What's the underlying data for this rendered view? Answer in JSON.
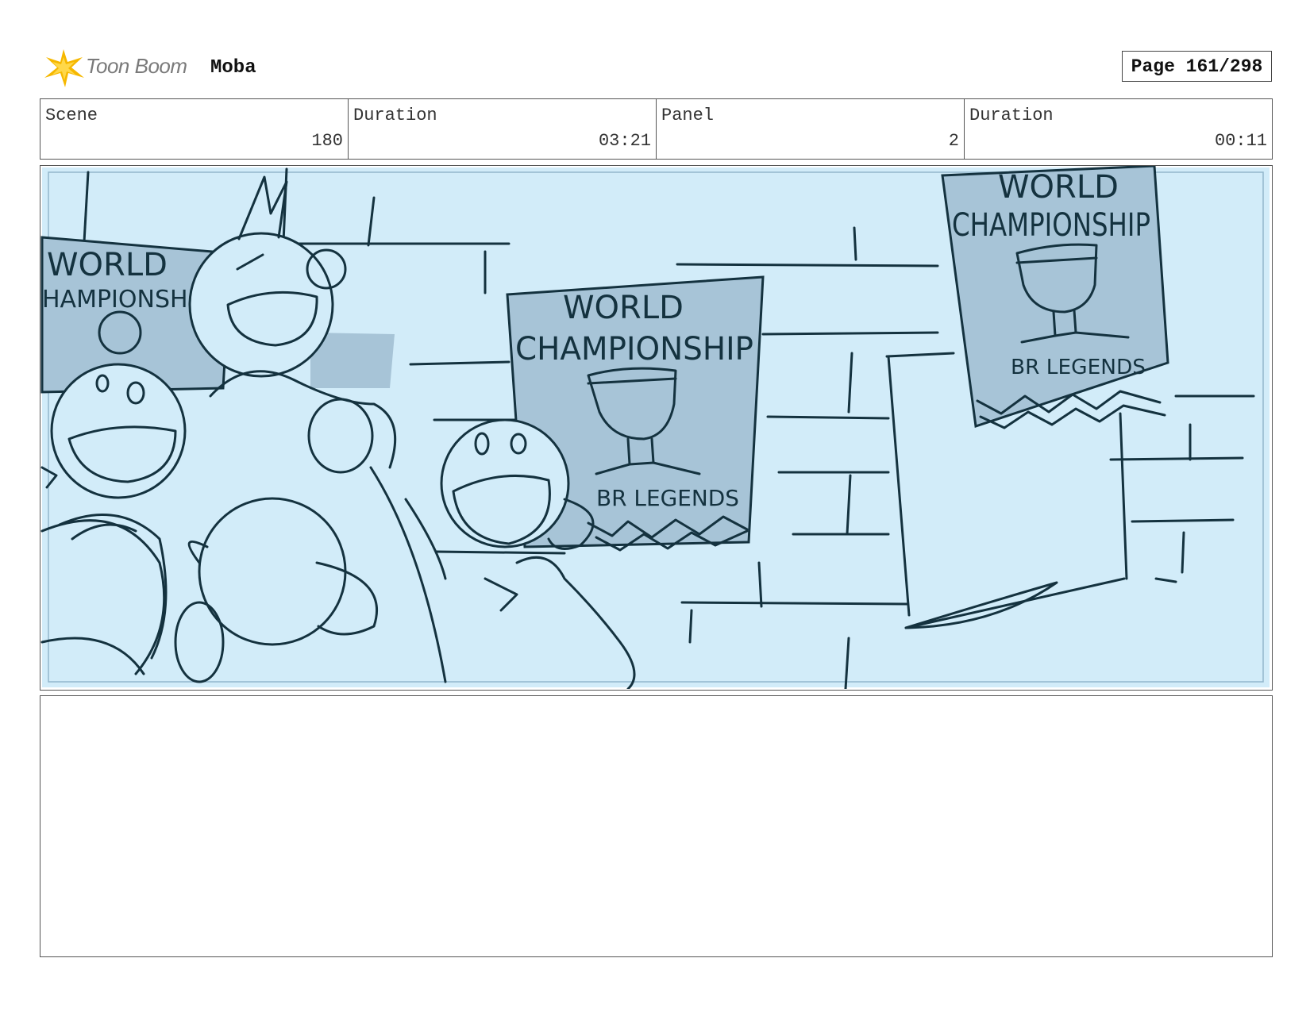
{
  "header": {
    "logo_text": "Toon Boom",
    "project": "Moba",
    "page": "Page 161/298"
  },
  "info": [
    {
      "label": "Scene",
      "value": "180"
    },
    {
      "label": "Duration",
      "value": "03:21"
    },
    {
      "label": "Panel",
      "value": "2"
    },
    {
      "label": "Duration",
      "value": "00:11"
    }
  ],
  "sketch": {
    "poster_left": [
      "WORLD",
      "HAMPIONSHI"
    ],
    "poster_center": [
      "WORLD",
      "CHAMPIONSHIP",
      "BR LEGENDS"
    ],
    "poster_right": [
      "WORLD",
      "CHAMPIONSHIP",
      "BR LEGENDS"
    ]
  },
  "notes": ""
}
